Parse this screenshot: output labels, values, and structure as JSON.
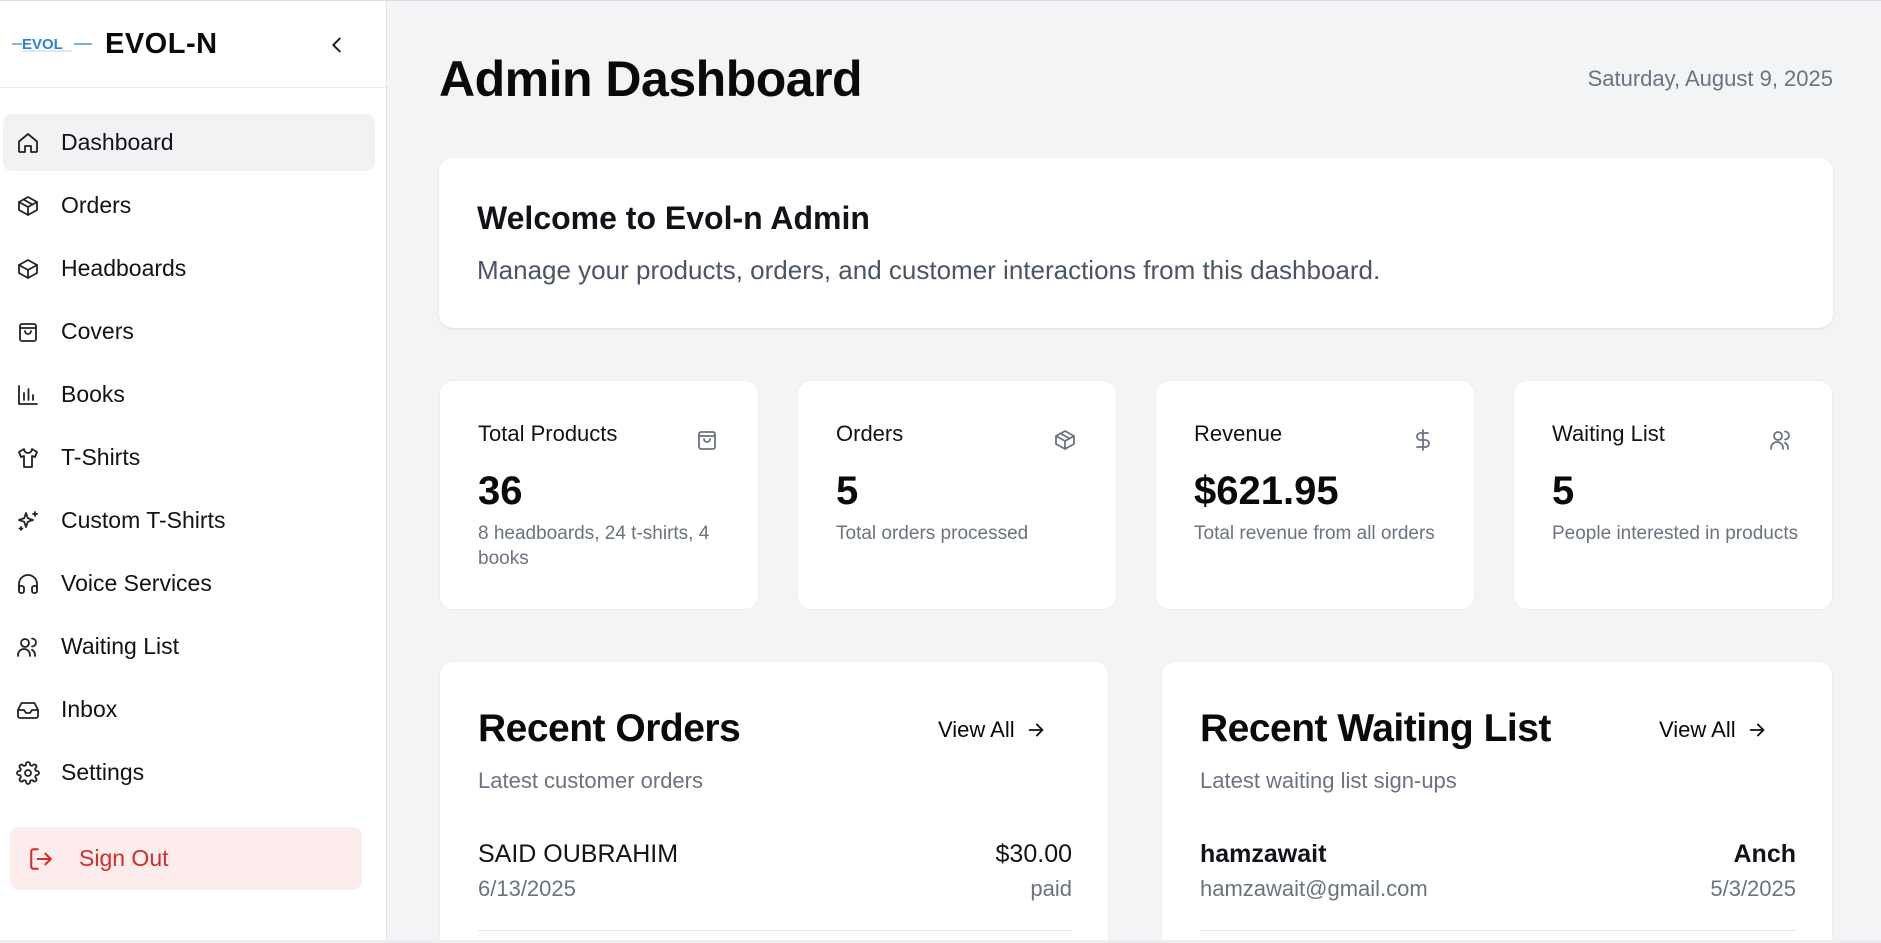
{
  "brand": {
    "name": "EVOL-N",
    "logo_text": "EVOL"
  },
  "sidebar": {
    "items": [
      {
        "label": "Dashboard",
        "icon": "home-icon",
        "active": true
      },
      {
        "label": "Orders",
        "icon": "package-icon"
      },
      {
        "label": "Headboards",
        "icon": "box-icon"
      },
      {
        "label": "Covers",
        "icon": "shopping-bag-icon"
      },
      {
        "label": "Books",
        "icon": "bar-chart-icon"
      },
      {
        "label": "T-Shirts",
        "icon": "shirt-icon"
      },
      {
        "label": "Custom T-Shirts",
        "icon": "sparkles-icon"
      },
      {
        "label": "Voice Services",
        "icon": "headphones-icon"
      },
      {
        "label": "Waiting List",
        "icon": "users-icon"
      },
      {
        "label": "Inbox",
        "icon": "inbox-icon"
      },
      {
        "label": "Settings",
        "icon": "settings-icon"
      }
    ],
    "signout_label": "Sign Out"
  },
  "header": {
    "title": "Admin Dashboard",
    "date": "Saturday, August 9, 2025"
  },
  "welcome": {
    "title": "Welcome to Evol-n Admin",
    "subtitle": "Manage your products, orders, and customer interactions from this dashboard."
  },
  "stats": [
    {
      "title": "Total Products",
      "value": "36",
      "desc": "8 headboards, 24 t-shirts, 4 books",
      "icon": "shopping-bag-icon"
    },
    {
      "title": "Orders",
      "value": "5",
      "desc": "Total orders processed",
      "icon": "package-icon"
    },
    {
      "title": "Revenue",
      "value": "$621.95",
      "desc": "Total revenue from all orders",
      "icon": "dollar-icon"
    },
    {
      "title": "Waiting List",
      "value": "5",
      "desc": "People interested in products",
      "icon": "users-icon"
    }
  ],
  "recent_orders": {
    "title": "Recent Orders",
    "view_all": "View All",
    "subtitle": "Latest customer orders",
    "rows": [
      {
        "name": "SAID OUBRAHIM",
        "date": "6/13/2025",
        "amount": "$30.00",
        "status": "paid"
      }
    ]
  },
  "recent_waiting": {
    "title": "Recent Waiting List",
    "view_all": "View All",
    "subtitle": "Latest waiting list sign-ups",
    "rows": [
      {
        "name": "hamzawait",
        "email": "hamzawait@gmail.com",
        "product": "Anch",
        "date": "5/3/2025"
      }
    ]
  },
  "colors": {
    "accent_red": "#d42b2b",
    "signout_bg": "#fdecec",
    "muted": "#6b7280"
  }
}
